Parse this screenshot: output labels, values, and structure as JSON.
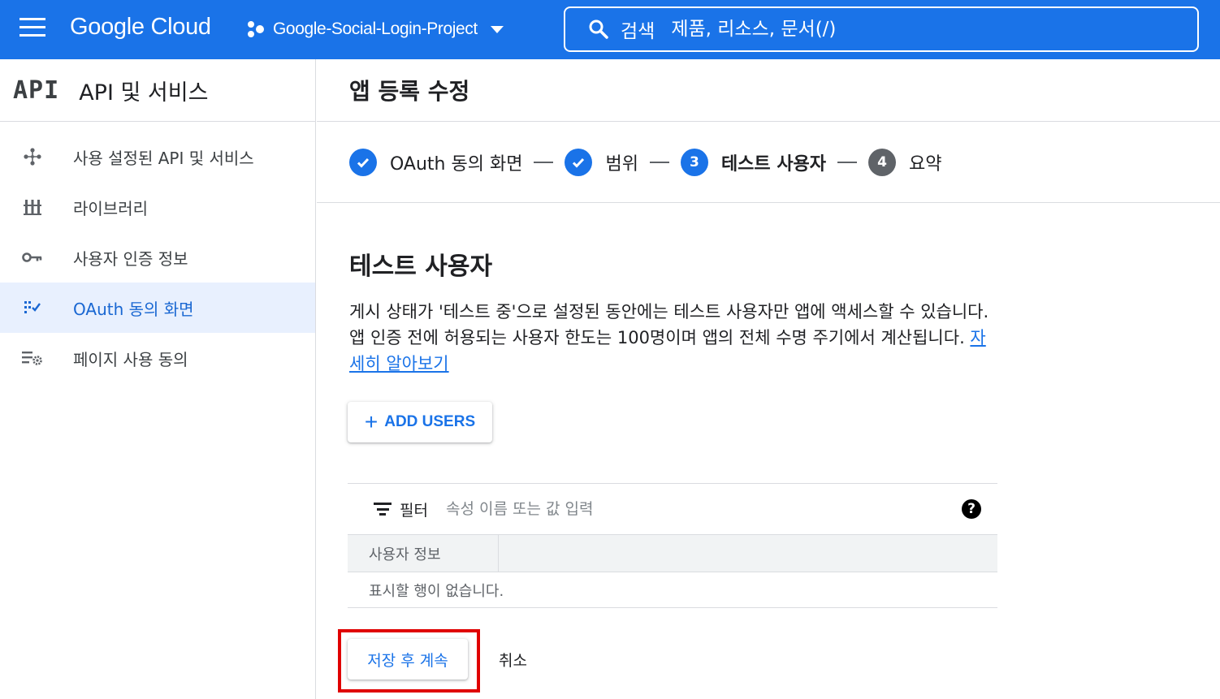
{
  "topbar": {
    "brand": "Google Cloud",
    "project_name": "Google-Social-Login-Project",
    "search_label": "검색",
    "search_placeholder": "제품, 리소스, 문서(/)"
  },
  "sidebar": {
    "logo_text": "API",
    "title": "API 및 서비스",
    "items": [
      {
        "label": "사용 설정된 API 및 서비스",
        "icon": "hub-icon",
        "active": false
      },
      {
        "label": "라이브러리",
        "icon": "library-icon",
        "active": false
      },
      {
        "label": "사용자 인증 정보",
        "icon": "key-icon",
        "active": false
      },
      {
        "label": "OAuth 동의 화면",
        "icon": "consent-icon",
        "active": true
      },
      {
        "label": "페이지 사용 동의",
        "icon": "settings-list-icon",
        "active": false
      }
    ]
  },
  "main": {
    "page_title": "앱 등록 수정",
    "steps": [
      {
        "label": "OAuth 동의 화면",
        "state": "done"
      },
      {
        "label": "범위",
        "state": "done"
      },
      {
        "number": "3",
        "label": "테스트 사용자",
        "state": "current"
      },
      {
        "number": "4",
        "label": "요약",
        "state": "todo"
      }
    ],
    "section_title": "테스트 사용자",
    "description": "게시 상태가 '테스트 중'으로 설정된 동안에는 테스트 사용자만 앱에 액세스할 수 있습니다. 앱 인증 전에 허용되는 사용자 한도는 100명이며 앱의 전체 수명 주기에서 계산됩니다. ",
    "learn_more": "자세히 알아보기",
    "add_users_label": "ADD USERS",
    "filter_label": "필터",
    "filter_placeholder": "속성 이름 또는 값 입력",
    "help_glyph": "?",
    "column_header": "사용자 정보",
    "empty_message": "표시할 행이 없습니다.",
    "save_label": "저장 후 계속",
    "cancel_label": "취소"
  },
  "colors": {
    "brand_blue": "#1a73e8",
    "active_bg": "#e8f0fe",
    "highlight_red": "#e00000"
  }
}
